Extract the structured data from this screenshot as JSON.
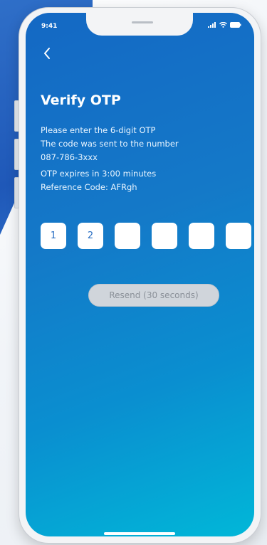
{
  "status_bar": {
    "time": "9:41"
  },
  "header": {
    "back_icon": "chevron-left-icon",
    "title": "Verify OTP"
  },
  "info": {
    "line1": "Please enter the 6-digit OTP",
    "line2": "The code was sent to the number",
    "phone": "087-786-3xxx",
    "expiry": "OTP expires in 3:00 minutes",
    "reference": "Reference Code: AFRgh"
  },
  "otp": {
    "digits": [
      "1",
      "2",
      "",
      "",
      "",
      ""
    ]
  },
  "resend": {
    "label": "Resend (30 seconds)"
  },
  "colors": {
    "screen_gradient_start": "#1468c4",
    "screen_gradient_end": "#01b7d8",
    "resend_bg": "#d0d5db"
  }
}
